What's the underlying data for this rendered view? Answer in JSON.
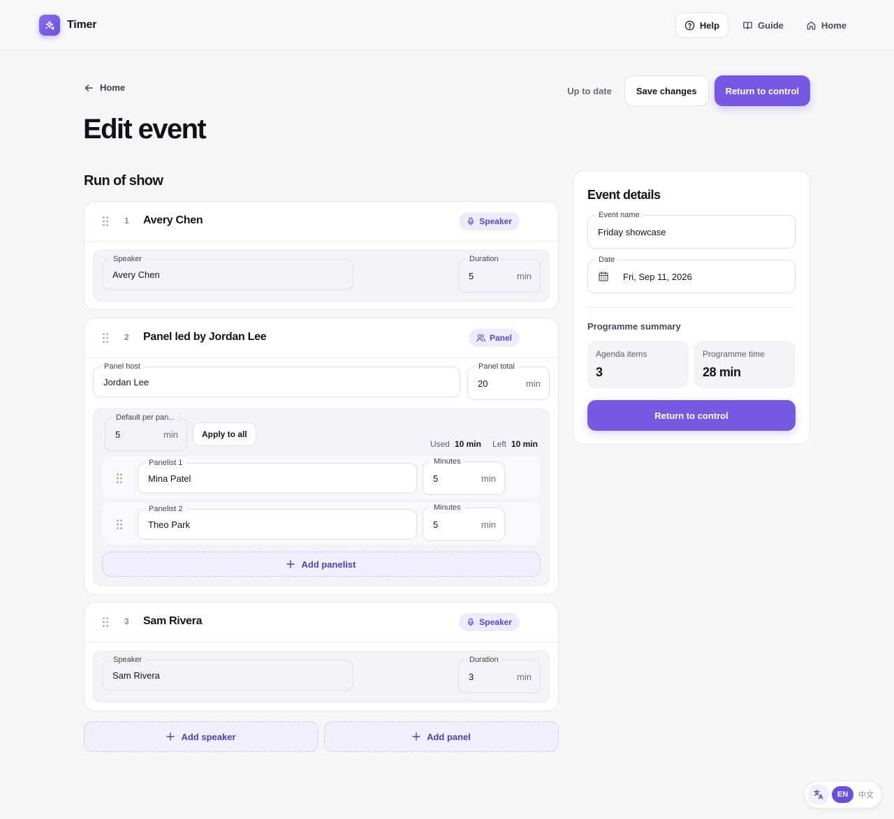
{
  "app": {
    "name": "Timer"
  },
  "nav": {
    "help": "Help",
    "guide": "Guide",
    "home": "Home"
  },
  "header": {
    "breadcrumb": "Home",
    "title": "Edit event",
    "status": "Up to date",
    "save_label": "Save changes",
    "return_label": "Return to control"
  },
  "run_of_show": {
    "title": "Run of show",
    "items": [
      {
        "number": "1",
        "title": "Avery Chen",
        "badge": "Speaker",
        "speaker_label": "Speaker",
        "speaker_value": "Avery Chen",
        "duration_label": "Duration",
        "duration_value": "5",
        "unit": "min"
      },
      {
        "number": "2",
        "title": "Panel led by Jordan Lee",
        "badge": "Panel",
        "host_label": "Panel host",
        "host_value": "Jordan Lee",
        "total_label": "Panel total",
        "total_value": "20",
        "unit": "min",
        "default_label": "Default per pan...",
        "default_value": "5",
        "apply_label": "Apply to all",
        "used_label": "Used",
        "used_value": "10 min",
        "left_label": "Left",
        "left_value": "10 min",
        "panelists": [
          {
            "label": "Panelist 1",
            "name": "Mina Patel",
            "minutes_label": "Minutes",
            "minutes": "5",
            "unit": "min"
          },
          {
            "label": "Panelist 2",
            "name": "Theo Park",
            "minutes_label": "Minutes",
            "minutes": "5",
            "unit": "min"
          }
        ],
        "add_panelist": "Add panelist"
      },
      {
        "number": "3",
        "title": "Sam Rivera",
        "badge": "Speaker",
        "speaker_label": "Speaker",
        "speaker_value": "Sam Rivera",
        "duration_label": "Duration",
        "duration_value": "3",
        "unit": "min"
      }
    ],
    "add_speaker": "Add speaker",
    "add_panel": "Add panel"
  },
  "details": {
    "title": "Event details",
    "name_label": "Event name",
    "name_value": "Friday showcase",
    "date_label": "Date",
    "date_value": "Fri, Sep 11, 2026",
    "summary_title": "Programme summary",
    "agenda_label": "Agenda items",
    "agenda_value": "3",
    "time_label": "Programme time",
    "time_value": "28 min",
    "return_label": "Return to control"
  },
  "language": {
    "active": "EN",
    "other": "中文"
  },
  "colors": {
    "accent": "#7658e3",
    "badge_bg": "#ececfb",
    "page_bg": "#f7f7f8"
  }
}
